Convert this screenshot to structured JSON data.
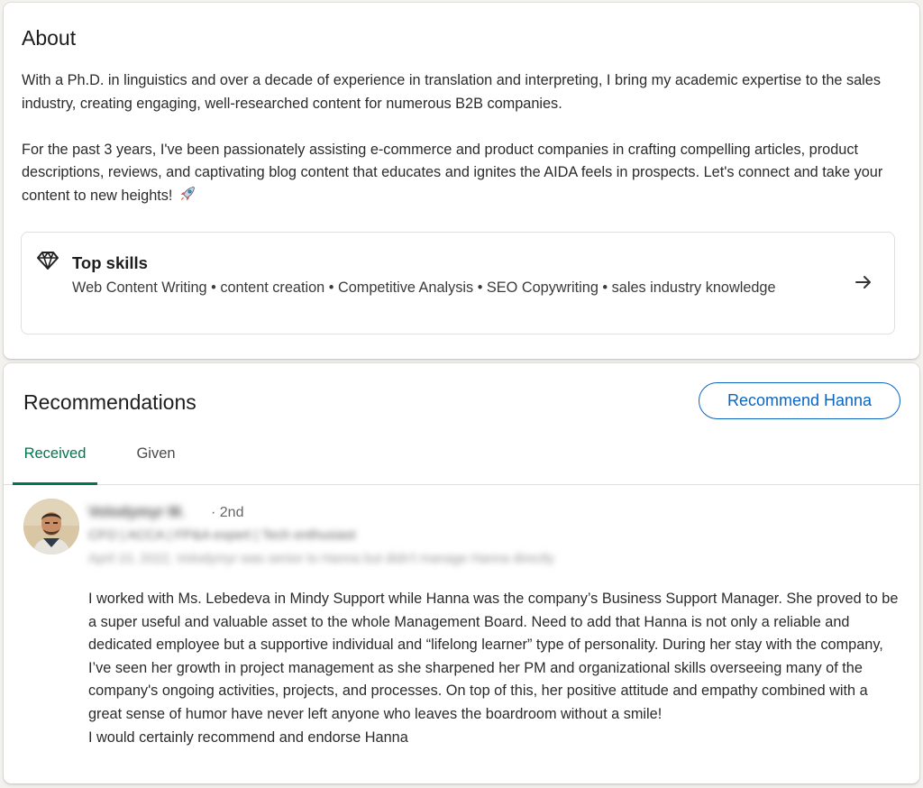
{
  "about": {
    "title": "About",
    "paragraph1": "With a Ph.D. in linguistics and over a decade of experience in translation and interpreting, I bring my academic expertise to the sales industry, creating engaging, well-researched content for numerous B2B companies.",
    "paragraph2": "For the past 3 years, I've been passionately assisting e-commerce and product companies in crafting compelling articles, product descriptions, reviews, and captivating blog content that educates and ignites the AIDA feels in prospects. Let's connect and take your content to new heights!",
    "rocket_icon": "rocket-emoji"
  },
  "top_skills": {
    "icon": "diamond-icon",
    "title": "Top skills",
    "skills": "Web Content Writing • content creation • Competitive Analysis • SEO Copywriting • sales industry knowledge",
    "arrow_icon": "arrow-right-icon"
  },
  "recommendations": {
    "title": "Recommendations",
    "button_label": "Recommend Hanna",
    "tabs": [
      {
        "label": "Received",
        "active": true
      },
      {
        "label": "Given",
        "active": false
      }
    ],
    "items": [
      {
        "name": "Volodymyr M.",
        "degree": "· 2nd",
        "headline": "CFO | ACCA | FP&A expert | Tech enthusiast",
        "meta": "April 10, 2022, Volodymyr was senior to Hanna but didn't manage Hanna directly",
        "body": [
          "I worked with Ms. Lebedeva in Mindy Support while Hanna was the company’s Business Support Manager. She proved to be a super useful and valuable asset to the whole Management Board. Need to add that Hanna is not only a reliable and dedicated employee but a supportive individual and “lifelong learner” type of personality. During her stay with the company, I’ve seen her growth in project management as she sharpened her PM and organizational skills overseeing many of the company's ongoing activities, projects, and processes. On top of this, her positive attitude and empathy combined with a great sense of humor have never left anyone who leaves the boardroom without a smile!",
          "I would certainly recommend and endorse Hanna"
        ]
      }
    ]
  },
  "colors": {
    "accent_blue": "#0a66c2",
    "active_tab_green": "#01754f"
  }
}
